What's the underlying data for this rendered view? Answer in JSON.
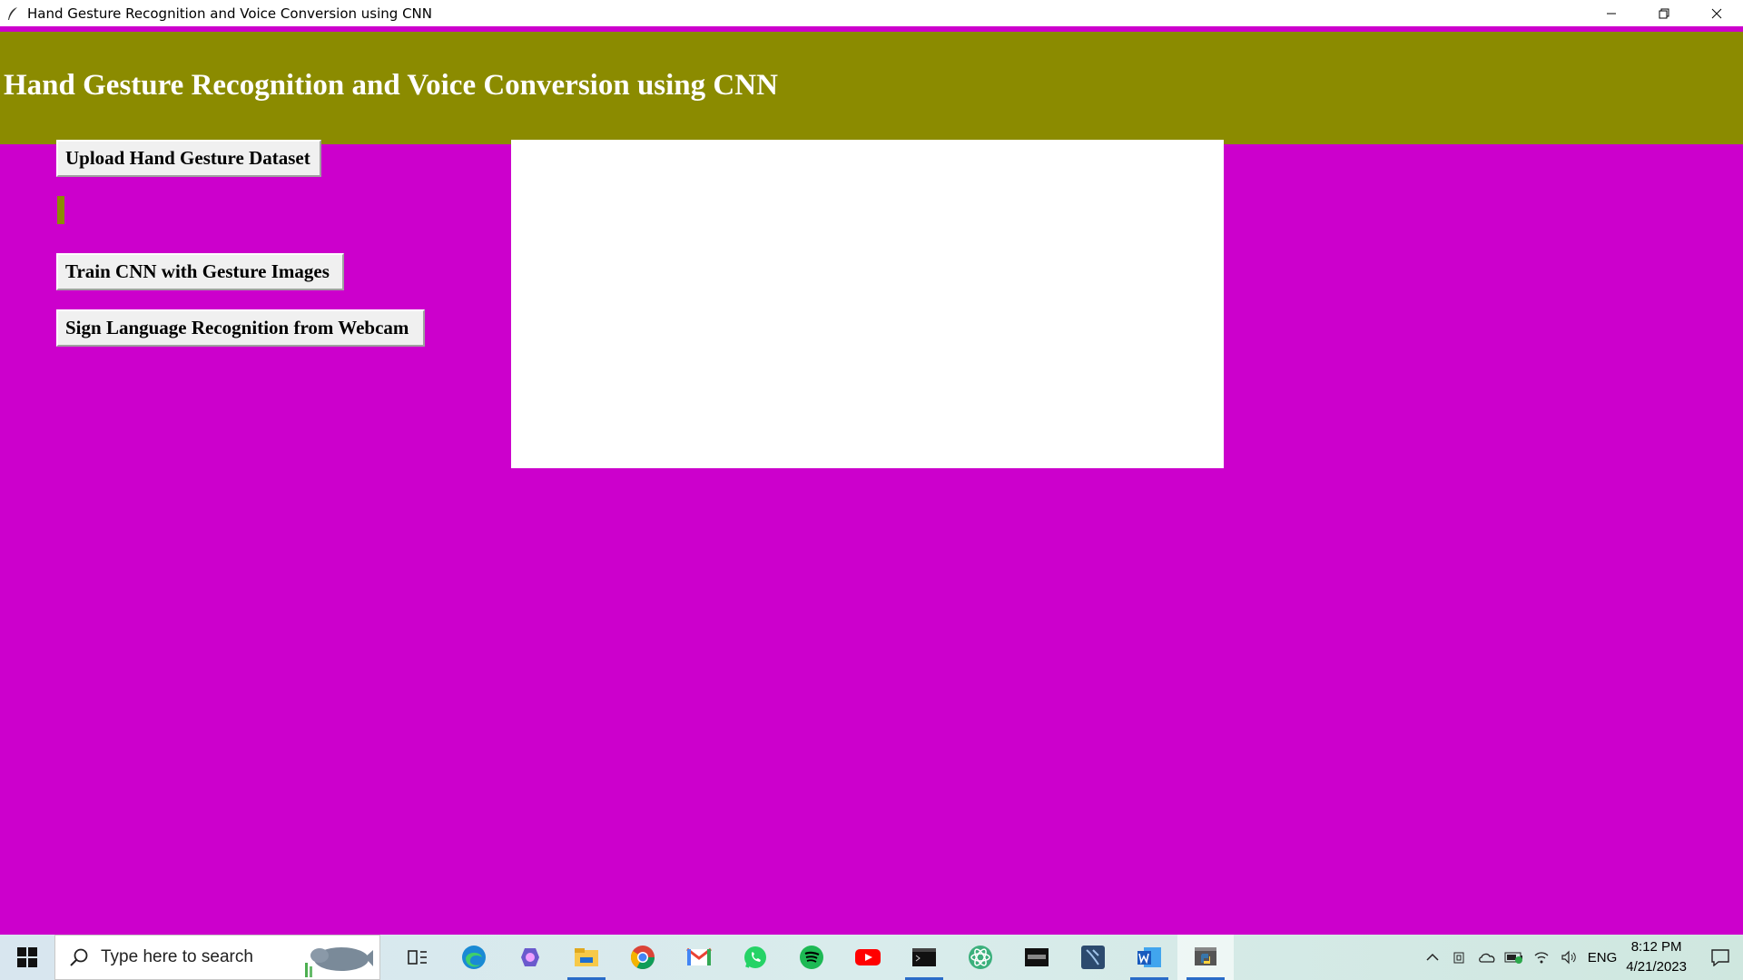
{
  "window": {
    "title": "Hand Gesture Recognition and Voice Conversion using CNN",
    "controls": [
      "minimize",
      "restore",
      "close"
    ]
  },
  "app": {
    "heading": "Hand Gesture Recognition and Voice Conversion using CNN",
    "buttons": {
      "upload": "Upload Hand Gesture Dataset",
      "train": "Train CNN with Gesture Images",
      "webcam": "Sign Language Recognition from Webcam"
    },
    "status_label": "",
    "output_text": ""
  },
  "colors": {
    "background": "#cc00cc",
    "heading_bg": "#8b8b00",
    "heading_text": "#ffffff",
    "button_bg": "#f0f0f0"
  },
  "taskbar": {
    "search_placeholder": "Type here to search",
    "pinned": [
      "task-view-icon",
      "edge-icon",
      "copilot-icon",
      "file-explorer-icon",
      "chrome-icon",
      "gmail-icon",
      "whatsapp-icon",
      "spotify-icon",
      "youtube-icon",
      "terminal-icon",
      "atom-icon",
      "mysql-icon",
      "workbench-icon",
      "word-icon",
      "python-icon"
    ],
    "tray": {
      "language": "ENG",
      "time": "8:12 PM",
      "date": "4/21/2023"
    }
  }
}
